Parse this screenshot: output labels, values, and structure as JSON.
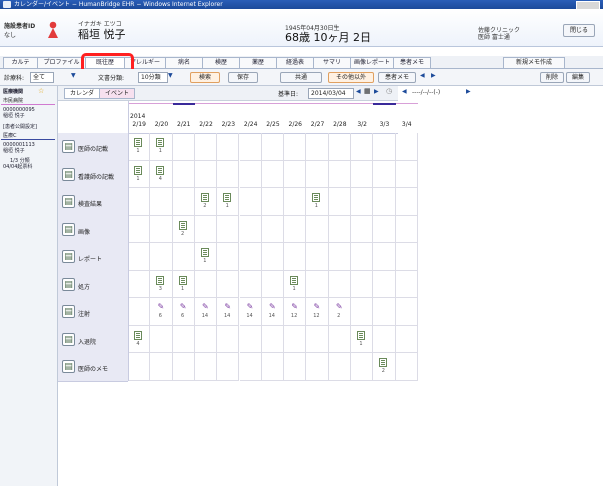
{
  "window": {
    "title": "カレンダー/イベント − HumanBridge EHR − Windows Internet Explorer"
  },
  "patient": {
    "id_label": "施設患者ID",
    "id_value": "なし",
    "kana": "イナガキ エツコ",
    "name": "稲垣 悦子",
    "birth": "1945年04月30日生",
    "age": "68歳 10ヶ月 2日",
    "facility": "佐藤クリニック",
    "doctor": "医師 富士通",
    "close_label": "閉じる"
  },
  "tabs": [
    {
      "label": "カルテ"
    },
    {
      "label": "プロファイル"
    },
    {
      "label": "既往歴"
    },
    {
      "label": "アレルギー"
    },
    {
      "label": "病名"
    },
    {
      "label": "検歴"
    },
    {
      "label": "薬歴"
    },
    {
      "label": "経過表"
    },
    {
      "label": "サマリ"
    },
    {
      "label": "画像レポート"
    },
    {
      "label": "患者メモ"
    }
  ],
  "new_memo_label": "新規メモ作成",
  "filter": {
    "dept_label": "診療科:",
    "dept_value": "全て",
    "doc_label": "文書分類:",
    "doc_value": "10分類",
    "search_label": "検索",
    "save_label": "保存",
    "shared_label": "共通",
    "other_label": "その他以外",
    "patient_memo_label": "患者メモ",
    "delete_label": "削除",
    "edit_label": "編集"
  },
  "sidebar": {
    "header": "医療機関",
    "section1_title": "市民病院",
    "section1_id": "0000000095",
    "section1_name": "稲垣 悦子",
    "section_note": "[患者公開設定]",
    "section2_title": "医療C",
    "section2_id": "0000001113",
    "section2_name": "稲垣 悦子",
    "section2_count": "1/3 分類",
    "section2_date": "04/04起票科"
  },
  "grid": {
    "subtab1": "カレンダ",
    "subtab2": "イベント",
    "base_label": "基準日:",
    "base_date": "2014/03/04",
    "range_text": "----/--/--(-)",
    "year": "2014",
    "dates": [
      "2/19",
      "2/20",
      "2/21",
      "2/22",
      "2/23",
      "2/24",
      "2/25",
      "2/26",
      "2/27",
      "2/28",
      "3/2",
      "3/3",
      "3/4"
    ],
    "rows": [
      {
        "label": "医師の記載",
        "icon": "doc-icon"
      },
      {
        "label": "看護師の記載",
        "icon": "doc-icon"
      },
      {
        "label": "検査結果",
        "icon": "test-icon"
      },
      {
        "label": "画像",
        "icon": "image-icon"
      },
      {
        "label": "レポート",
        "icon": "report-icon"
      },
      {
        "label": "処方",
        "icon": "rx-icon"
      },
      {
        "label": "注射",
        "icon": "syringe-icon"
      },
      {
        "label": "入退院",
        "icon": "bed-icon"
      },
      {
        "label": "医師のメモ",
        "icon": "memo-icon"
      }
    ],
    "events": [
      [
        {
          "col": 0,
          "n": "1"
        },
        {
          "col": 1,
          "n": "1"
        }
      ],
      [
        {
          "col": 0,
          "n": "1"
        },
        {
          "col": 1,
          "n": "4"
        }
      ],
      [
        {
          "col": 3,
          "n": "2"
        },
        {
          "col": 4,
          "n": "1"
        },
        {
          "col": 8,
          "n": "1"
        }
      ],
      [
        {
          "col": 2,
          "n": "2"
        }
      ],
      [
        {
          "col": 3,
          "n": "1"
        }
      ],
      [
        {
          "col": 1,
          "n": "3"
        },
        {
          "col": 2,
          "n": "1"
        },
        {
          "col": 7,
          "n": "1"
        }
      ],
      [
        {
          "col": 1,
          "n": "6"
        },
        {
          "col": 2,
          "n": "6"
        },
        {
          "col": 3,
          "n": "14"
        },
        {
          "col": 4,
          "n": "14"
        },
        {
          "col": 5,
          "n": "14"
        },
        {
          "col": 6,
          "n": "14"
        },
        {
          "col": 7,
          "n": "12"
        },
        {
          "col": 8,
          "n": "12"
        },
        {
          "col": 9,
          "n": "2"
        }
      ],
      [
        {
          "col": 0,
          "n": "4"
        },
        {
          "col": 10,
          "n": "1"
        }
      ],
      [
        {
          "col": 11,
          "n": "2"
        }
      ]
    ]
  },
  "colors": {
    "accent_blue": "#1c4a9a",
    "highlight_red": "#ff2020",
    "row_header": "#e8e9f4"
  }
}
